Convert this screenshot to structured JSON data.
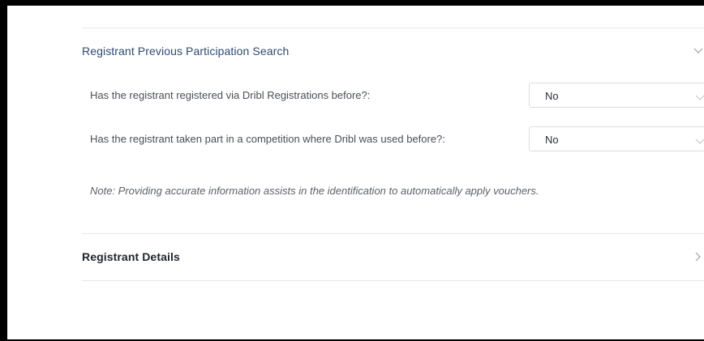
{
  "sections": {
    "previous_participation": {
      "title": "Registrant Previous Participation Search",
      "expanded_icon": "chevron-down-icon",
      "fields": [
        {
          "label": "Has the registrant registered via Dribl Registrations before?:",
          "value": "No"
        },
        {
          "label": "Has the registrant taken part in a competition where Dribl was used before?:",
          "value": "No"
        }
      ],
      "note": "Note: Providing accurate information assists in the identification to automatically apply vouchers."
    },
    "registrant_details": {
      "title": "Registrant Details",
      "collapsed_icon": "chevron-right-icon"
    }
  },
  "colors": {
    "frame": "#000000",
    "panel": "#ffffff",
    "divider": "#e6e7ea",
    "select_border": "#d9dce1"
  }
}
